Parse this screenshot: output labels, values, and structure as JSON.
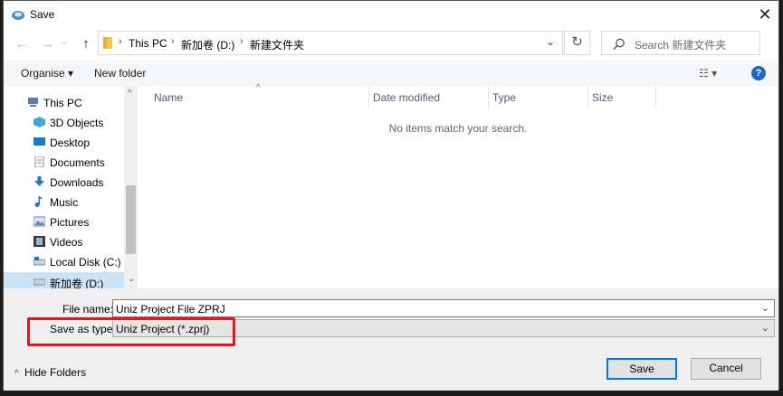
{
  "window": {
    "title": "Save",
    "close_glyph": "✕"
  },
  "nav": {
    "back_glyph": "←",
    "forward_glyph": "→",
    "down_glyph": "⌄",
    "up_glyph": "↑",
    "refresh_glyph": "↻"
  },
  "address": {
    "crumbs": [
      "This PC",
      "新加卷 (D:)",
      "新建文件夹"
    ],
    "separator": "›",
    "dropdown_glyph": "⌄"
  },
  "search": {
    "placeholder": "Search 新建文件夹",
    "icon": "search-icon"
  },
  "toolbar": {
    "organise": "Organise ▾",
    "new_folder": "New folder",
    "view_glyph": "☷ ▾",
    "help_glyph": "?"
  },
  "sidebar": {
    "items": [
      {
        "label": "This PC",
        "icon": "computer-icon",
        "color": "#5a7ea6"
      },
      {
        "label": "3D Objects",
        "icon": "cube-icon",
        "color": "#46a6d8"
      },
      {
        "label": "Desktop",
        "icon": "desktop-icon",
        "color": "#1e78c8"
      },
      {
        "label": "Documents",
        "icon": "document-icon",
        "color": "#8a8f96"
      },
      {
        "label": "Downloads",
        "icon": "download-icon",
        "color": "#1e78c8"
      },
      {
        "label": "Music",
        "icon": "music-icon",
        "color": "#1e78c8"
      },
      {
        "label": "Pictures",
        "icon": "pictures-icon",
        "color": "#5f87b3"
      },
      {
        "label": "Videos",
        "icon": "video-icon",
        "color": "#3c3c3c"
      },
      {
        "label": "Local Disk (C:)",
        "icon": "drive-icon",
        "color": "#7c8c99"
      },
      {
        "label": "新加卷 (D:)",
        "icon": "drive-icon",
        "color": "#7c8c99"
      }
    ],
    "scroll_up": "^",
    "scroll_down": "⌄"
  },
  "columns": {
    "name": "Name",
    "date": "Date modified",
    "type": "Type",
    "size": "Size",
    "sort_glyph": "^"
  },
  "empty_message": "No items match your search.",
  "file_name": {
    "label": "File name:",
    "value": "Uniz Project File ZPRJ",
    "dropdown_glyph": "⌄"
  },
  "save_type": {
    "label": "Save as type:",
    "value": "Uniz Project (*.zprj)",
    "dropdown_glyph": "⌄"
  },
  "hide_folders": {
    "glyph": "^",
    "label": "Hide Folders"
  },
  "buttons": {
    "save": "Save",
    "cancel": "Cancel"
  },
  "colors": {
    "accent": "#0078d7",
    "highlight_box": "#e8161b",
    "selection": "#cce3f6"
  }
}
